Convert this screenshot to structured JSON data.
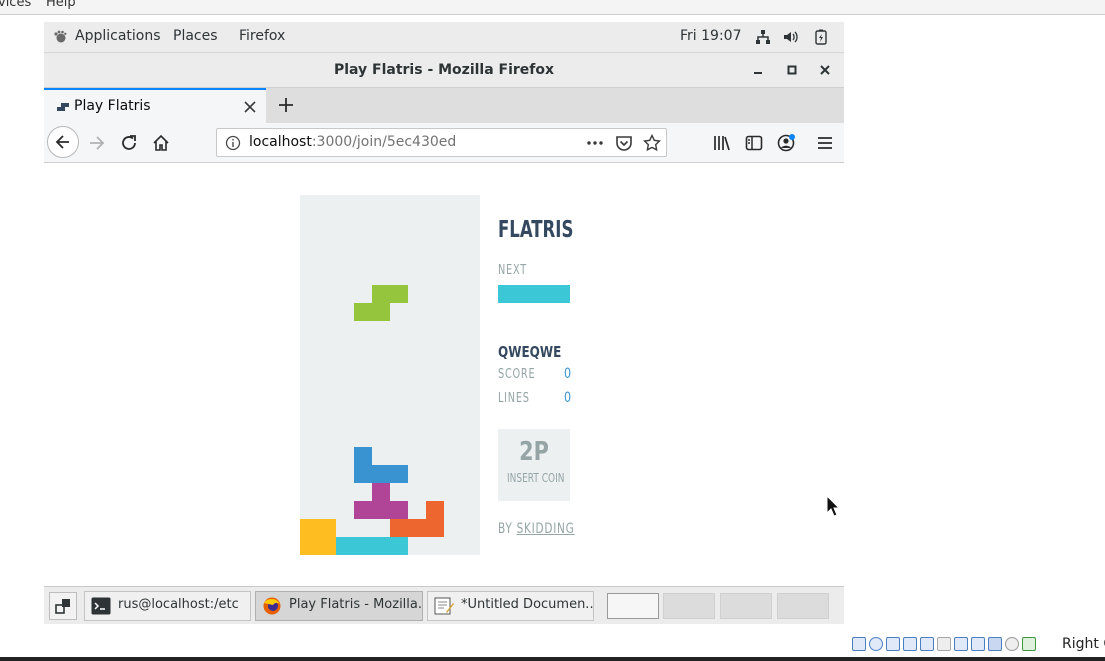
{
  "host": {
    "menubar": {
      "left_fragment": "vices",
      "help": "Help"
    },
    "status_right_label": "Right C"
  },
  "gnome": {
    "applications": "Applications",
    "places": "Places",
    "firefox": "Firefox",
    "clock": "Fri 19:07"
  },
  "window": {
    "title": "Play Flatris - Mozilla Firefox"
  },
  "tabs": [
    {
      "label": "Play Flatris",
      "active": true
    }
  ],
  "urlbar": {
    "host": "localhost",
    "path": ":3000/join/5ec430ed"
  },
  "game": {
    "title": "FLATRIS",
    "next_label": "NEXT",
    "next_piece": "I",
    "player_name": "QWEQWE",
    "score_label": "SCORE",
    "score": "0",
    "lines_label": "LINES",
    "lines": "0",
    "two_player_big": "2P",
    "two_player_small": "INSERT COIN",
    "by_label": "BY",
    "by_link": "SKIDDING",
    "colors": {
      "well": "#ecf0f1",
      "green": "#95c43d",
      "blue": "#3993d0",
      "purple": "#b04497",
      "orange": "#ed652f",
      "yellow": "#febd20",
      "cyan": "#3cc7d6"
    }
  },
  "taskbar": {
    "items": [
      {
        "label": "rus@localhost:/etc",
        "icon": "terminal-icon",
        "active": false
      },
      {
        "label": "Play Flatris - Mozilla...",
        "icon": "firefox-icon",
        "active": true
      },
      {
        "label": "*Untitled Documen...",
        "icon": "text-editor-icon",
        "active": false
      }
    ],
    "workspaces": 4,
    "current_workspace": 1
  }
}
